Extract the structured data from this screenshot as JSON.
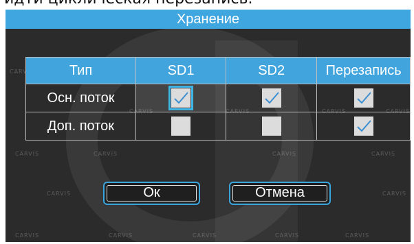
{
  "top_caption": "идти циклическая перезапись.",
  "dialog": {
    "title": "Хранение",
    "watermark": "CARVIS"
  },
  "table": {
    "headers": [
      "Тип",
      "SD1",
      "SD2",
      "Перезапись"
    ],
    "rows": [
      {
        "label": "Осн. поток",
        "sd1": true,
        "sd2": true,
        "rewrite": true
      },
      {
        "label": "Доп. поток",
        "sd1": false,
        "sd2": false,
        "rewrite": true
      }
    ]
  },
  "buttons": {
    "ok": "Ок",
    "cancel": "Отмена"
  },
  "colors": {
    "accent": "#40a6df",
    "background": "#2b2b2b",
    "checkmark": "#3d8fd1",
    "checkbox": "#dcdcdc"
  }
}
